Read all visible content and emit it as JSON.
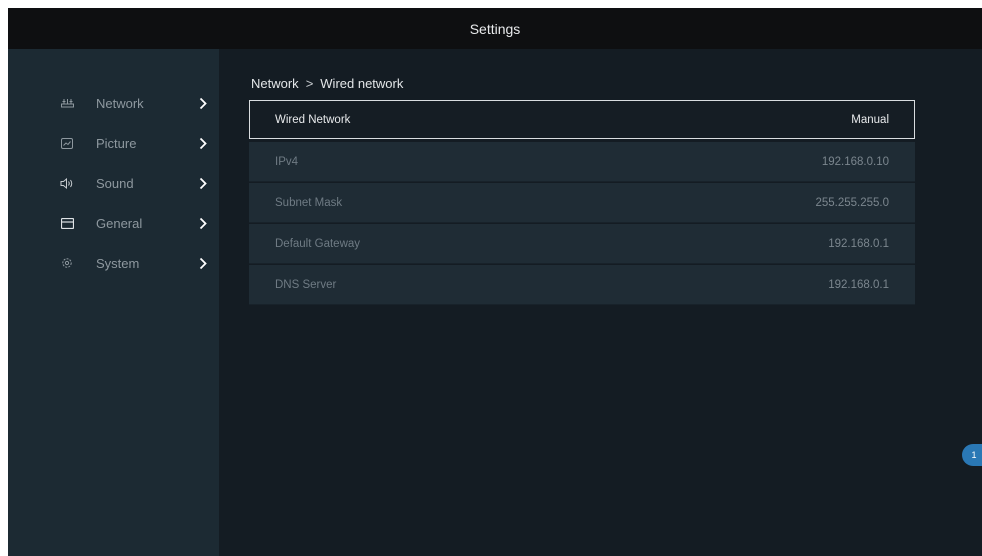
{
  "window": {
    "title": "Settings"
  },
  "sidebar": {
    "items": [
      {
        "label": "Network",
        "icon": "network-icon"
      },
      {
        "label": "Picture",
        "icon": "picture-icon"
      },
      {
        "label": "Sound",
        "icon": "sound-icon"
      },
      {
        "label": "General",
        "icon": "general-icon"
      },
      {
        "label": "System",
        "icon": "system-icon"
      }
    ]
  },
  "breadcrumb": {
    "parent": "Network",
    "separator": ">",
    "current": "Wired network"
  },
  "network": {
    "rows": [
      {
        "label": "Wired Network",
        "value": "Manual"
      },
      {
        "label": "IPv4",
        "value": "192.168.0.10"
      },
      {
        "label": "Subnet Mask",
        "value": "255.255.255.0"
      },
      {
        "label": "Default Gateway",
        "value": "192.168.0.1"
      },
      {
        "label": "DNS Server",
        "value": "192.168.0.1"
      }
    ]
  },
  "page_badge": "1",
  "colors": {
    "background": "#141c23",
    "topbar": "#0e0f11",
    "sidebar": "#1c2a33",
    "row": "#1f2c35",
    "selected_border": "#d9dde0",
    "badge": "#2a78b5"
  }
}
